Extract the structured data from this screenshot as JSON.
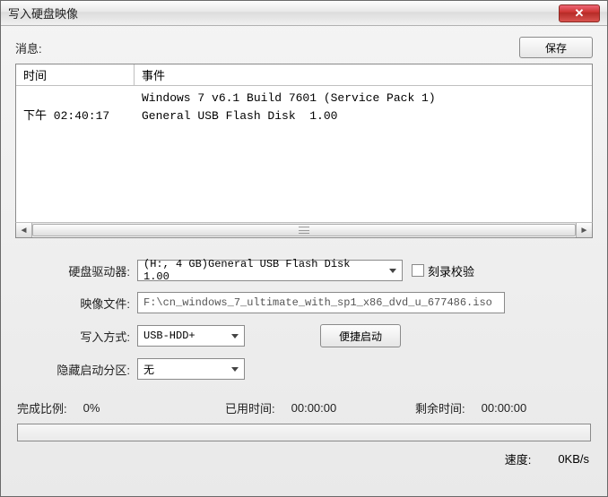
{
  "titlebar": {
    "title": "写入硬盘映像"
  },
  "info": {
    "label": "消息:"
  },
  "buttons": {
    "save": "保存",
    "quick_boot": "便捷启动"
  },
  "log": {
    "header_time": "时间",
    "header_event": "事件",
    "rows": [
      {
        "time": "",
        "event": "Windows 7 v6.1 Build 7601 (Service Pack 1)"
      },
      {
        "time": "下午 02:40:17",
        "event": "General USB Flash Disk  1.00"
      }
    ]
  },
  "form": {
    "drive_label": "硬盘驱动器:",
    "drive_value": "(H:, 4 GB)General USB Flash Disk  1.00",
    "verify_label": "刻录校验",
    "image_label": "映像文件:",
    "image_value": "F:\\cn_windows_7_ultimate_with_sp1_x86_dvd_u_677486.iso",
    "method_label": "写入方式:",
    "method_value": "USB-HDD+",
    "hide_label": "隐藏启动分区:",
    "hide_value": "无"
  },
  "stats": {
    "percent_label": "完成比例:",
    "percent_value": "0%",
    "elapsed_label": "已用时间:",
    "elapsed_value": "00:00:00",
    "remaining_label": "剩余时间:",
    "remaining_value": "00:00:00",
    "speed_label": "速度:",
    "speed_value": "0KB/s"
  }
}
